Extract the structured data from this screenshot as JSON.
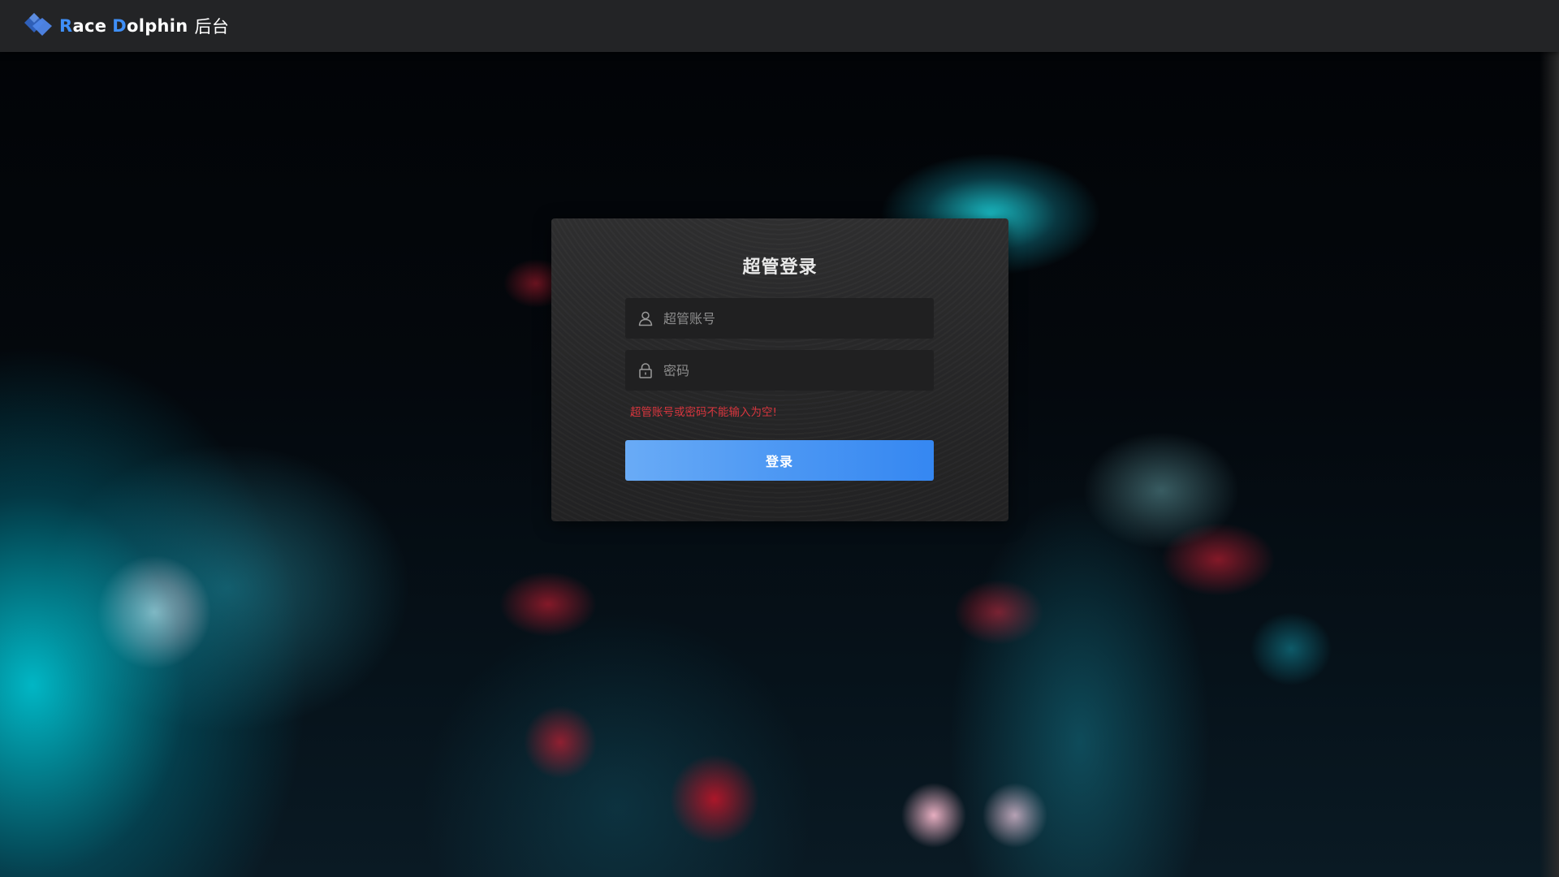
{
  "header": {
    "brand_first_initial": "R",
    "brand_first_rest": "ace",
    "brand_second_initial": "D",
    "brand_second_rest": "olphin",
    "brand_suffix": "后台",
    "logo_icon": "diamond-logo-icon"
  },
  "login": {
    "title": "超管登录",
    "account": {
      "placeholder": "超管账号",
      "value": "",
      "icon": "user-icon"
    },
    "password": {
      "placeholder": "密码",
      "value": "",
      "icon": "lock-icon"
    },
    "error_message": "超管账号或密码不能输入为空!",
    "submit_label": "登录"
  },
  "colors": {
    "header_bg": "#232426",
    "card_bg": "#2a2a2b",
    "accent_blue": "#3f8ff7",
    "button_gradient_start": "#69abf6",
    "button_gradient_end": "#3587f2",
    "error_red": "#d9363e"
  }
}
